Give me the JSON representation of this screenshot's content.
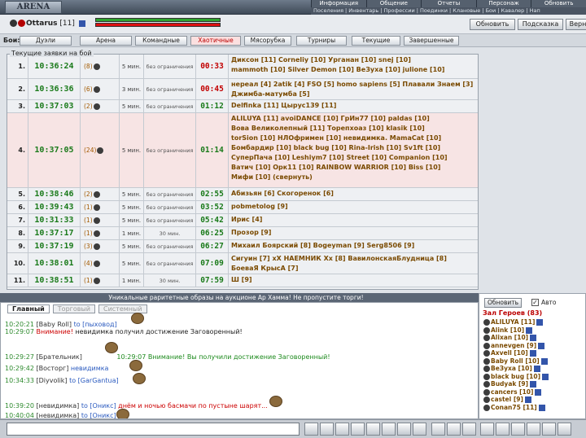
{
  "header": {
    "logo": "ARENA",
    "menu": [
      "Информация",
      "Общение",
      "Отчеты",
      "Персонаж",
      "Обновить"
    ],
    "submenu": "Поселения | Инвентарь | Профессии | Поединки | Клановые | Бои | Кавалер | Нап"
  },
  "user": {
    "name": "Ottarus",
    "level": "[11]"
  },
  "actions": {
    "refresh": "Обновить",
    "hint": "Подсказка",
    "back": "Верн"
  },
  "tabs": {
    "label": "Бои:",
    "items": [
      "Дуэли",
      "Арена",
      "Командные",
      "Хаотичные",
      "Мясорубка",
      "Турниры",
      "Текущие",
      "Завершенные"
    ],
    "active": "Хаотичные"
  },
  "bids": {
    "legend": "Текущие заявки на бой",
    "rows": [
      {
        "num": "1.",
        "time": "10:36:24",
        "cnt": "(8)",
        "min": "5 мин.",
        "lim": "без ограничения",
        "cd": "00:33",
        "red": true,
        "lines": [
          {
            "a": "Диксон [11]  Corneliy [10]  Урганан [10]",
            "b": "snej [10]"
          },
          {
            "a": "mammoth [10]  Silver Demon [10]  ВеЗуха [10]",
            "b": "julione [10]"
          }
        ]
      },
      {
        "num": "2.",
        "time": "10:36:36",
        "cnt": "(6)",
        "min": "3 мин.",
        "lim": "без ограничения",
        "cd": "00:45",
        "red": true,
        "lines": [
          {
            "a": "нереал [4]  2atik [4]  FSO [5]  homo sapiens [5]",
            "b": "Плавали Знаем [3]"
          },
          {
            "a": "Джимба-матумба [5]",
            "b": ""
          }
        ]
      },
      {
        "num": "3.",
        "time": "10:37:03",
        "cnt": "(2)",
        "min": "5 мин.",
        "lim": "без ограничения",
        "cd": "01:12",
        "red": false,
        "lines": [
          {
            "a": "Delfinka [11]",
            "b": "Цырус139 [11]"
          }
        ]
      },
      {
        "num": "4.",
        "time": "10:37:05",
        "cnt": "(24)",
        "min": "5 мин.",
        "lim": "без ограничения",
        "cd": "01:14",
        "red": false,
        "lines": [
          {
            "a": "ALILUYA [11]  avoiDANCE [10]  ГрИн77 [10]",
            "b": "paldas [10]"
          },
          {
            "a": "Вова Великолепный [11]  Торепхоаз [10]",
            "b": "klasik [10]"
          },
          {
            "a": "torSion [10]  НЛОфримен [10] невидимка.",
            "b": "MamaCat [10]"
          },
          {
            "a": "Бомбардир [10]  black bug [10]  Rina-Irish [10]",
            "b": "Sv1ft [10]"
          },
          {
            "a": "СуперПача [10]  Leshiym7 [10]  Street [10]",
            "b": "Companion [10]"
          },
          {
            "a": "Ватич [10]  Орк11 [10]  RAINBOW WARRIOR [10]",
            "b": "Biss [10]"
          },
          {
            "a": "Мифи [10] (свернуть)",
            "b": ""
          }
        ]
      },
      {
        "num": "5.",
        "time": "10:38:46",
        "cnt": "(2)",
        "min": "5 мин.",
        "lim": "без ограничения",
        "cd": "02:55",
        "red": false,
        "lines": [
          {
            "a": "Абизьян [6]",
            "b": "Скогоренок [6]"
          }
        ]
      },
      {
        "num": "6.",
        "time": "10:39:43",
        "cnt": "(1)",
        "min": "5 мин.",
        "lim": "без ограничения",
        "cd": "03:52",
        "red": false,
        "lines": [
          {
            "a": "pobmetolog [9]",
            "b": ""
          }
        ]
      },
      {
        "num": "7.",
        "time": "10:31:33",
        "cnt": "(1)",
        "min": "5 мин.",
        "lim": "без ограничения",
        "cd": "05:42",
        "red": false,
        "lines": [
          {
            "a": "Ирис [4]",
            "b": ""
          }
        ]
      },
      {
        "num": "8.",
        "time": "10:37:17",
        "cnt": "(1)",
        "min": "1 мин.",
        "lim": "30 мин.",
        "cd": "06:25",
        "red": false,
        "lines": [
          {
            "a": "Прозор [9]",
            "b": ""
          }
        ]
      },
      {
        "num": "9.",
        "time": "10:37:19",
        "cnt": "(3)",
        "min": "5 мин.",
        "lim": "без ограничения",
        "cd": "06:27",
        "red": false,
        "lines": [
          {
            "a": "Михаил Боярский [8]  Bogeyman [9]",
            "b": "Serg8506 [9]"
          }
        ]
      },
      {
        "num": "10.",
        "time": "10:38:01",
        "cnt": "(4)",
        "min": "5 мин.",
        "lim": "без ограничения",
        "cd": "07:09",
        "red": false,
        "lines": [
          {
            "a": "Сигуин [7]  xX НАЕМНИК Xx [8]  ВавилонскаяБлудница [8]",
            "b": ""
          },
          {
            "a": "БоеваЯ КрысА [7]",
            "b": ""
          }
        ]
      },
      {
        "num": "11.",
        "time": "10:38:51",
        "cnt": "(1)",
        "min": "1 мин.",
        "lim": "30 мин.",
        "cd": "07:59",
        "red": false,
        "lines": [
          {
            "a": "Ш [9]",
            "b": ""
          }
        ]
      }
    ]
  },
  "chat": {
    "banner": "Уникальные раритетные образы на аукционе Ар Хамма! Не пропустите торги!",
    "tabs": [
      "Главный",
      "Торговый",
      "Системный"
    ],
    "messages": [
      {
        "time": "10:20:21",
        "nick": "[Baby Roll]",
        "to": "to [пыховод]",
        "text": ""
      },
      {
        "time": "10:29:07",
        "nick": "",
        "to": "",
        "sys": "Внимание! ",
        "text": "невидимка получил достижение Заговоренный!"
      },
      {
        "time": "10:29:27",
        "nick": "[Брательник]",
        "to": "",
        "text": "10:29:07 Внимание! Вы получили достижение Заговоренный!"
      },
      {
        "time": "10:29:42",
        "nick": "[Восторг]",
        "to": "невидимка",
        "text": ""
      },
      {
        "time": "10:34:33",
        "nick": "[Diyvolik]",
        "to": "to [GarGantua]",
        "text": ""
      },
      {
        "time": "10:39:20",
        "nick": "[невидимка]",
        "to": "to [Оникс]",
        "text": "днём и ночью басмачи по пустыне шарят..."
      },
      {
        "time": "10:40:04",
        "nick": "[невидимка]",
        "to": "to [Оникс]",
        "text": ""
      }
    ]
  },
  "sidebar": {
    "refresh": "Обновить",
    "auto": "Авто",
    "hall": "Зал Героев (83)",
    "players": [
      "ALILUYA [11]",
      "Alink [10]",
      "Alixan [10]",
      "annevgen [9]",
      "Axvell [10]",
      "Baby Roll [10]",
      "ВеЗуха [10]",
      "black bug [10]",
      "Budyak [9]",
      "cancers [10]",
      "castel [9]",
      "Conan75 [11]"
    ]
  }
}
